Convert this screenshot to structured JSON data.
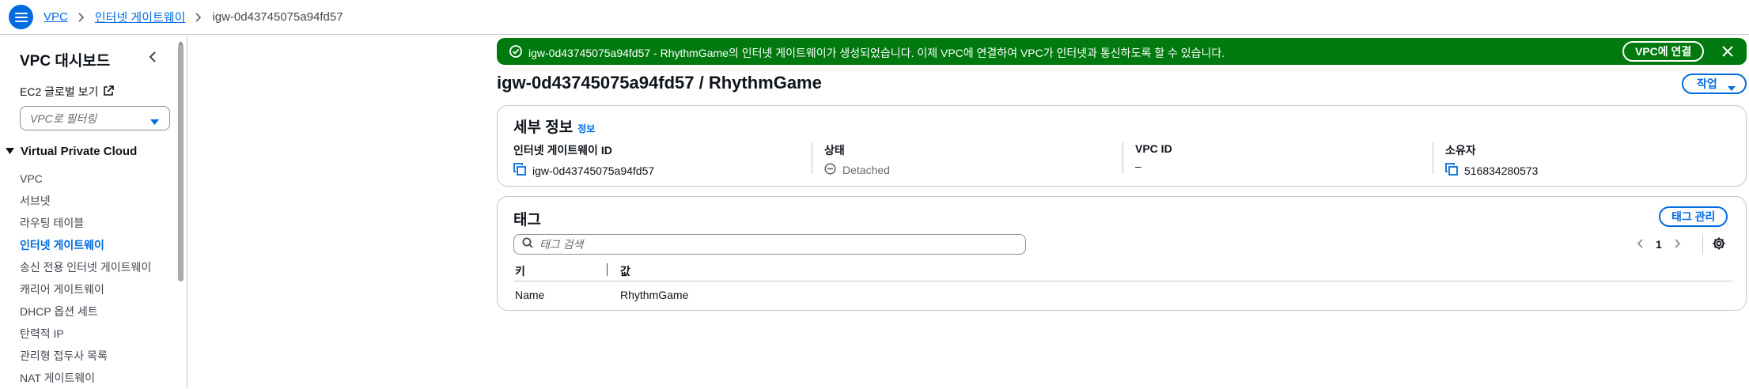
{
  "breadcrumb": {
    "items": [
      "VPC",
      "인터넷 게이트웨이"
    ],
    "current": "igw-0d43745075a94fd57"
  },
  "sidebar": {
    "title": "VPC 대시보드",
    "ec2_link": "EC2 글로벌 보기",
    "filter_placeholder": "VPC로 필터링",
    "section": "Virtual Private Cloud",
    "items": [
      {
        "label": "VPC"
      },
      {
        "label": "서브넷"
      },
      {
        "label": "라우팅 테이블"
      },
      {
        "label": "인터넷 게이트웨이",
        "active": true
      },
      {
        "label": "송신 전용 인터넷 게이트웨이"
      },
      {
        "label": "캐리어 게이트웨이"
      },
      {
        "label": "DHCP 옵션 세트"
      },
      {
        "label": "탄력적 IP"
      },
      {
        "label": "관리형 접두사 목록"
      },
      {
        "label": "NAT 게이트웨이"
      }
    ]
  },
  "flash": {
    "message": "igw-0d43745075a94fd57 - RhythmGame의 인터넷 게이트웨이가 생성되었습니다. 이제 VPC에 연결하여 VPC가 인터넷과 통신하도록 할 수 있습니다.",
    "action_label": "VPC에 연결"
  },
  "page": {
    "title": "igw-0d43745075a94fd57 / RhythmGame",
    "actions_label": "작업"
  },
  "details": {
    "heading": "세부 정보",
    "info_label": "정보",
    "igw_id_label": "인터넷 게이트웨이 ID",
    "igw_id": "igw-0d43745075a94fd57",
    "state_label": "상태",
    "state": "Detached",
    "vpc_id_label": "VPC ID",
    "vpc_id": "–",
    "owner_label": "소유자",
    "owner": "516834280573"
  },
  "tags": {
    "heading": "태그",
    "manage_label": "태그 관리",
    "search_placeholder": "태그 검색",
    "page": "1",
    "col_key": "키",
    "col_value": "값",
    "rows": [
      {
        "key": "Name",
        "value": "RhythmGame"
      }
    ]
  },
  "colors": {
    "accent": "#006ce0",
    "success": "#007a0e",
    "border": "#c6c6cd"
  }
}
